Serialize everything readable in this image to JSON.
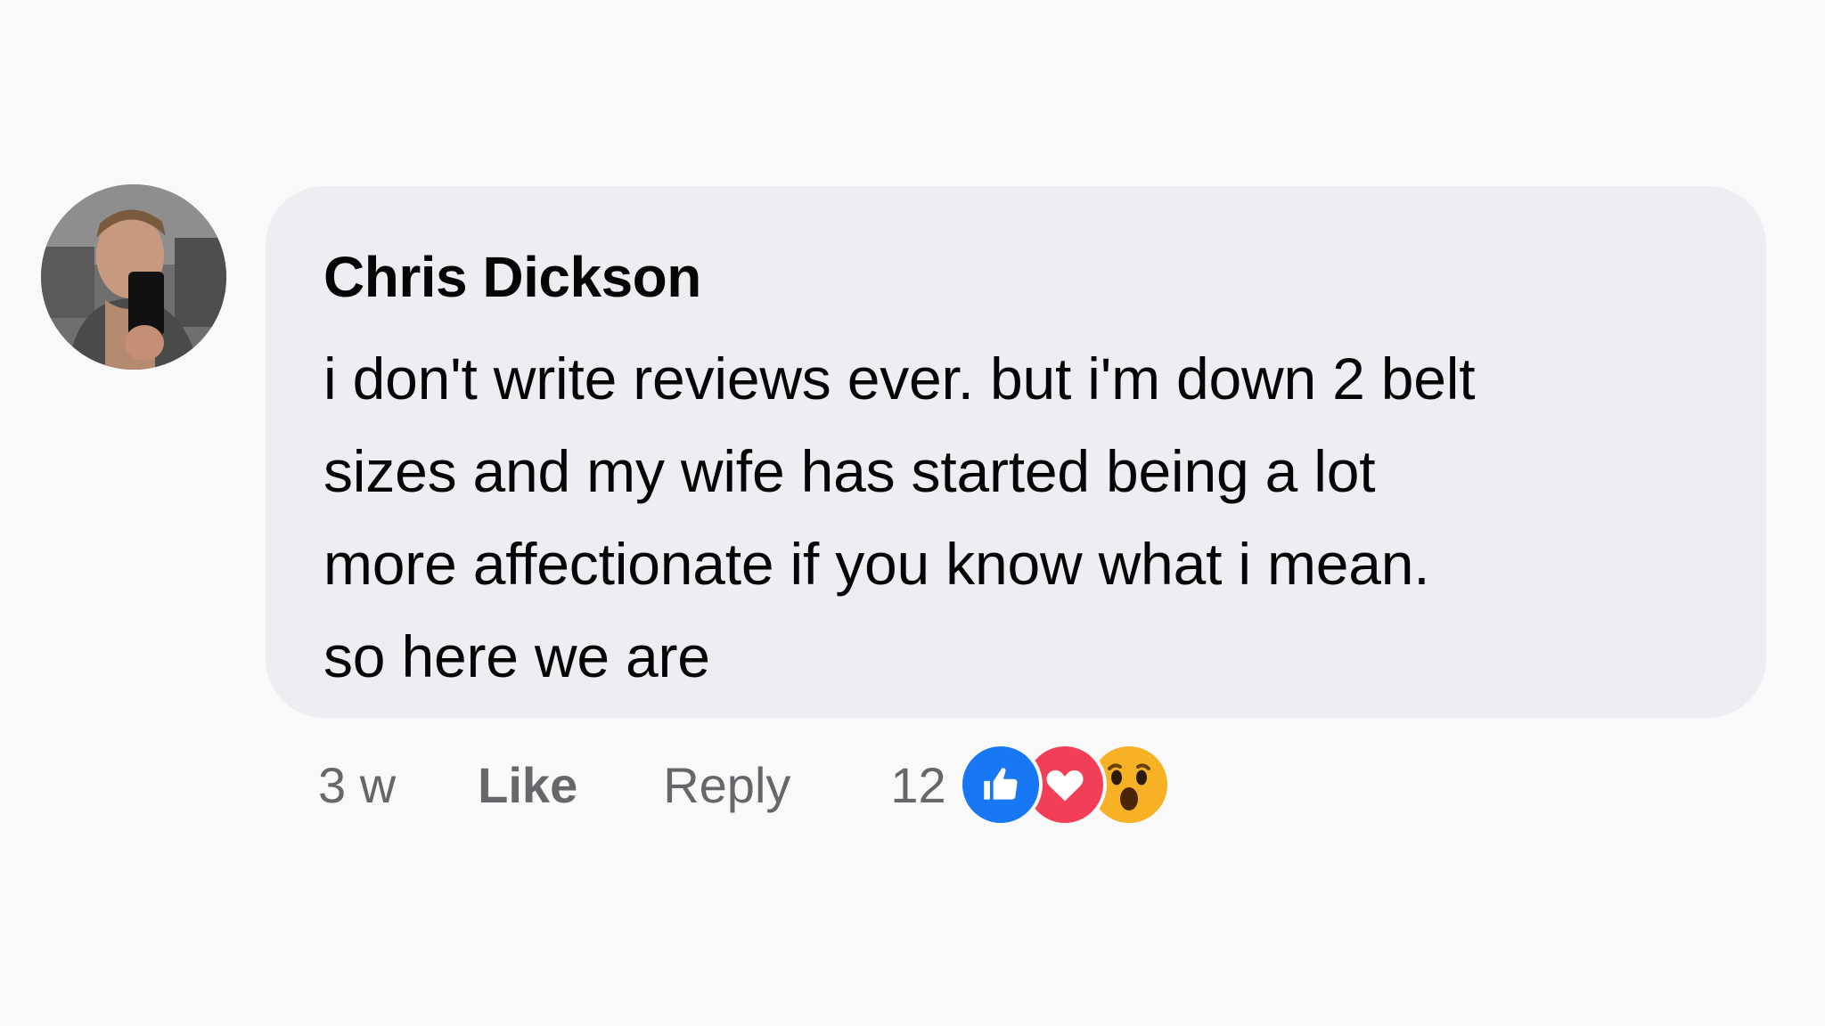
{
  "comment": {
    "author": "Chris Dickson",
    "text": "i don't write reviews ever. but i'm down 2 belt\nsizes and my wife has started being a lot\nmore affectionate if you know what i mean.\nso here we are",
    "timestamp": "3 w",
    "like_label": "Like",
    "reply_label": "Reply",
    "reaction_count": "12",
    "reactions": [
      "like-icon",
      "love-icon",
      "wow-icon"
    ]
  },
  "colors": {
    "bubble": "#eeeef2",
    "like": "#1877f2",
    "love": "#f33e58",
    "wow": "#f7b125",
    "meta_text": "#65676b"
  }
}
